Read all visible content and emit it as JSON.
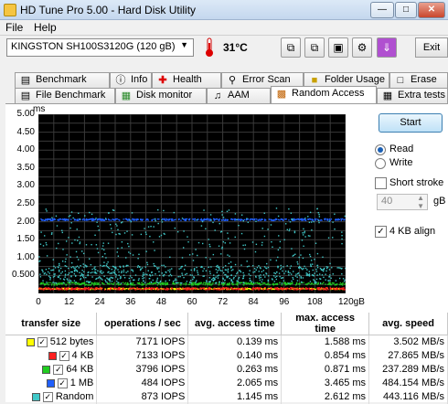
{
  "window": {
    "title": "HD Tune Pro 5.00 - Hard Disk Utility"
  },
  "menu": [
    "File",
    "Help"
  ],
  "toolbar": {
    "drive": "KINGSTON SH100S3120G   (120 gB)",
    "temperature": "31°C",
    "exit_label": "Exit"
  },
  "tabs_row1": [
    {
      "label": "Benchmark"
    },
    {
      "label": "Info"
    },
    {
      "label": "Health"
    },
    {
      "label": "Error Scan"
    },
    {
      "label": "Folder Usage"
    },
    {
      "label": "Erase"
    }
  ],
  "tabs_row2": [
    {
      "label": "File Benchmark"
    },
    {
      "label": "Disk monitor"
    },
    {
      "label": "AAM"
    },
    {
      "label": "Random Access"
    },
    {
      "label": "Extra tests"
    }
  ],
  "controls": {
    "start_label": "Start",
    "read_label": "Read",
    "write_label": "Write",
    "mode": "Read",
    "short_stroke_label": "Short stroke",
    "short_stroke_checked": false,
    "stroke_value": "40",
    "stroke_unit": "gB",
    "align_label": "4 KB align",
    "align_checked": true
  },
  "chart_data": {
    "type": "scatter",
    "ylabel": "ms",
    "xlim": [
      0,
      120
    ],
    "ylim": [
      0,
      5
    ],
    "yticks": [
      "5.00",
      "4.50",
      "4.00",
      "3.50",
      "3.00",
      "2.50",
      "2.00",
      "1.50",
      "1.00",
      "0.500"
    ],
    "xticks": [
      "0",
      "12",
      "24",
      "36",
      "48",
      "60",
      "72",
      "84",
      "96",
      "108",
      "120gB"
    ],
    "grid": true,
    "series": [
      {
        "name": "512 bytes",
        "color": "#ffff00",
        "band": [
          0.13,
          0.16
        ]
      },
      {
        "name": "4 KB",
        "color": "#ff2020",
        "band": [
          0.12,
          0.18
        ]
      },
      {
        "name": "64 KB",
        "color": "#20cc20",
        "band": [
          0.25,
          0.32
        ]
      },
      {
        "name": "1 MB",
        "color": "#2060ff",
        "band": [
          2.05,
          2.1
        ]
      },
      {
        "name": "Random",
        "color": "#40c8c8",
        "band": [
          0.3,
          2.4
        ]
      }
    ]
  },
  "results": {
    "headers": [
      "transfer size",
      "operations / sec",
      "avg. access time",
      "max. access time",
      "avg. speed"
    ],
    "rows": [
      {
        "size": "512 bytes",
        "color": "#ffff00",
        "ops": "7171 IOPS",
        "avg": "0.139 ms",
        "max": "1.588 ms",
        "speed": "3.502 MB/s"
      },
      {
        "size": "4 KB",
        "color": "#ff2020",
        "ops": "7133 IOPS",
        "avg": "0.140 ms",
        "max": "0.854 ms",
        "speed": "27.865 MB/s"
      },
      {
        "size": "64 KB",
        "color": "#20cc20",
        "ops": "3796 IOPS",
        "avg": "0.263 ms",
        "max": "0.871 ms",
        "speed": "237.289 MB/s"
      },
      {
        "size": "1 MB",
        "color": "#2060ff",
        "ops": "484 IOPS",
        "avg": "2.065 ms",
        "max": "3.465 ms",
        "speed": "484.154 MB/s"
      },
      {
        "size": "Random",
        "color": "#40c8c8",
        "ops": "873 IOPS",
        "avg": "1.145 ms",
        "max": "2.612 ms",
        "speed": "443.116 MB/s"
      }
    ]
  }
}
